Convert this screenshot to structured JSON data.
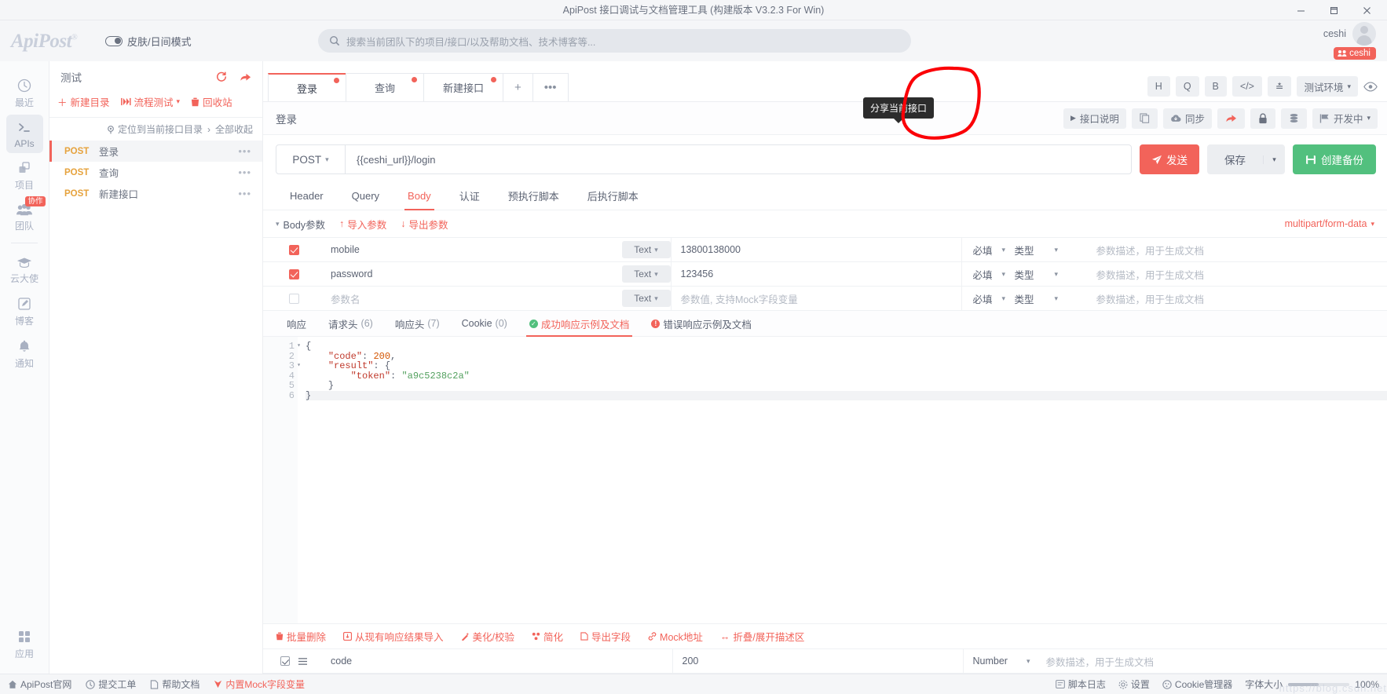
{
  "window": {
    "title": "ApiPost 接口调试与文档管理工具 (构建版本 V3.2.3 For Win)",
    "minimize": "—",
    "maximize": "▢",
    "close": "✕"
  },
  "header": {
    "logo": "ApiPost",
    "logo_mark": "®",
    "skin_label": "皮肤/日间模式",
    "search_placeholder": "搜索当前团队下的项目/接口/以及帮助文档、技术博客等...",
    "user_name": "ceshi",
    "team_badge": "ceshi"
  },
  "rail": {
    "items": [
      {
        "label": "最近",
        "icon": "clock-icon",
        "active": false,
        "badge": ""
      },
      {
        "label": "APIs",
        "icon": "terminal-icon",
        "active": true,
        "badge": ""
      },
      {
        "label": "项目",
        "icon": "project-icon",
        "active": false,
        "badge": ""
      },
      {
        "label": "团队",
        "icon": "team-icon",
        "active": false,
        "badge": "协作"
      },
      {
        "label": "云大使",
        "icon": "graduation-icon",
        "active": false,
        "badge": ""
      },
      {
        "label": "博客",
        "icon": "blog-icon",
        "active": false,
        "badge": ""
      },
      {
        "label": "通知",
        "icon": "bell-icon",
        "active": false,
        "badge": ""
      }
    ],
    "bottom": {
      "label": "应用",
      "icon": "apps-icon"
    }
  },
  "tree": {
    "title": "测试",
    "tools": [
      {
        "label": "新建目录",
        "icon": "plus-icon"
      },
      {
        "label": "流程测试",
        "icon": "flow-icon",
        "caret": "▾"
      },
      {
        "label": "回收站",
        "icon": "trash-icon"
      }
    ],
    "locate_label": "定位到当前接口目录",
    "collapse_label": "全部收起",
    "collapse_caret": "›",
    "items": [
      {
        "method": "POST",
        "name": "登录",
        "active": true
      },
      {
        "method": "POST",
        "name": "查询",
        "active": false
      },
      {
        "method": "POST",
        "name": "新建接口",
        "active": false
      }
    ],
    "row_menu": "•••"
  },
  "tabs": [
    {
      "label": "登录",
      "active": true,
      "dot": true
    },
    {
      "label": "查询",
      "active": false,
      "dot": true
    },
    {
      "label": "新建接口",
      "active": false,
      "dot": true
    }
  ],
  "tab_add": "+",
  "tab_more": "•••",
  "subhead": {
    "name": "登录",
    "doc_button": "接口说明",
    "sync_button": "同步",
    "status_button": "开发中",
    "status_caret": "▾",
    "copy_icon": "copy-icon",
    "share_icon": "share-icon",
    "lock_icon": "lock-icon",
    "layers_icon": "layers-icon",
    "flag_icon": "flag-icon",
    "env_label": "测试环境",
    "env_caret": "▾",
    "view_icon": "eye-icon",
    "mode_icons": [
      "H",
      "Q",
      "B",
      "</>",
      "≛"
    ]
  },
  "url": {
    "method": "POST",
    "method_caret": "▾",
    "value": "{{ceshi_url}}/login",
    "send": "发送",
    "save": "保存",
    "save_caret": "▾",
    "backup": "创建备份"
  },
  "param_tabs": [
    {
      "label": "Header",
      "active": false
    },
    {
      "label": "Query",
      "active": false
    },
    {
      "label": "Body",
      "active": true
    },
    {
      "label": "认证",
      "active": false
    },
    {
      "label": "预执行脚本",
      "active": false
    },
    {
      "label": "后执行脚本",
      "active": false
    }
  ],
  "body_bar": {
    "title": "Body参数",
    "caret": "▾",
    "import": "导入参数",
    "export": "导出参数",
    "content_type": "multipart/form-data",
    "content_caret": "▾"
  },
  "body_params": {
    "columns": [
      "",
      "参数名",
      "类型",
      "参数值",
      "必填",
      "类型",
      "参数描述"
    ],
    "rows": [
      {
        "checked": true,
        "name": "mobile",
        "type": "Text",
        "value": "13800138000",
        "required": "必填",
        "dtype": "类型",
        "desc": "参数描述，用于生成文档",
        "placeholder": false
      },
      {
        "checked": true,
        "name": "password",
        "type": "Text",
        "value": "123456",
        "required": "必填",
        "dtype": "类型",
        "desc": "参数描述，用于生成文档",
        "placeholder": false
      },
      {
        "checked": false,
        "name": "参数名",
        "type": "Text",
        "value": "参数值, 支持Mock字段变量",
        "required": "必填",
        "dtype": "类型",
        "desc": "参数描述，用于生成文档",
        "placeholder": true
      }
    ]
  },
  "response_tabs": [
    {
      "label": "响应",
      "count": "",
      "active": false,
      "icon": ""
    },
    {
      "label": "请求头",
      "count": "(6)",
      "active": false,
      "icon": ""
    },
    {
      "label": "响应头",
      "count": "(7)",
      "active": false,
      "icon": ""
    },
    {
      "label": "Cookie",
      "count": "(0)",
      "active": false,
      "icon": ""
    },
    {
      "label": "成功响应示例及文档",
      "count": "",
      "active": true,
      "icon": "success-icon"
    },
    {
      "label": "错误响应示例及文档",
      "count": "",
      "active": false,
      "icon": "error-icon"
    }
  ],
  "editor": {
    "lines": [
      {
        "no": "1",
        "fold": "▾",
        "html": "{"
      },
      {
        "no": "2",
        "fold": "",
        "html": "    <span class='k'>\"code\"</span><span class='p'>:</span> <span class='n'>200</span><span class='p'>,</span>"
      },
      {
        "no": "3",
        "fold": "▾",
        "html": "    <span class='k'>\"result\"</span><span class='p'>: {</span>"
      },
      {
        "no": "4",
        "fold": "",
        "html": "        <span class='k'>\"token\"</span><span class='p'>:</span> <span class='s'>\"a9c5238c2a\"</span>"
      },
      {
        "no": "5",
        "fold": "",
        "html": "    <span class='p'>}</span>"
      },
      {
        "no": "6",
        "fold": "",
        "html": "<span class='p'>}</span>",
        "highlight": true
      }
    ]
  },
  "editor_tools": [
    {
      "label": "批量删除",
      "icon": "trash-icon"
    },
    {
      "label": "从现有响应结果导入",
      "icon": "import-icon"
    },
    {
      "label": "美化/校验",
      "icon": "wand-icon"
    },
    {
      "label": "简化",
      "icon": "simplify-icon"
    },
    {
      "label": "导出字段",
      "icon": "export-icon"
    },
    {
      "label": "Mock地址",
      "icon": "link-icon"
    },
    {
      "label": "折叠/展开描述区",
      "icon": "collapse-icon"
    }
  ],
  "field_row": {
    "name": "code",
    "value": "200",
    "type": "Number",
    "type_caret": "▾",
    "desc": "参数描述，用于生成文档",
    "menu_icon": "menu-icon"
  },
  "statusbar": {
    "left": [
      {
        "label": "ApiPost官网",
        "icon": "home-icon",
        "red": false
      },
      {
        "label": "提交工单",
        "icon": "ticket-icon",
        "red": false
      },
      {
        "label": "帮助文档",
        "icon": "doc-icon",
        "red": false
      },
      {
        "label": "内置Mock字段变量",
        "icon": "mock-icon",
        "red": true
      }
    ],
    "right": [
      {
        "label": "脚本日志",
        "icon": "log-icon"
      },
      {
        "label": "设置",
        "icon": "gear-icon"
      },
      {
        "label": "Cookie管理器",
        "icon": "cookie-icon"
      }
    ],
    "zoom_label": "字体大小",
    "zoom_value": "100%",
    "watermark": "https://blog.csdn.net"
  },
  "annotation": {
    "tooltip": "分享当前接口",
    "circle_color": "#fb0007"
  }
}
